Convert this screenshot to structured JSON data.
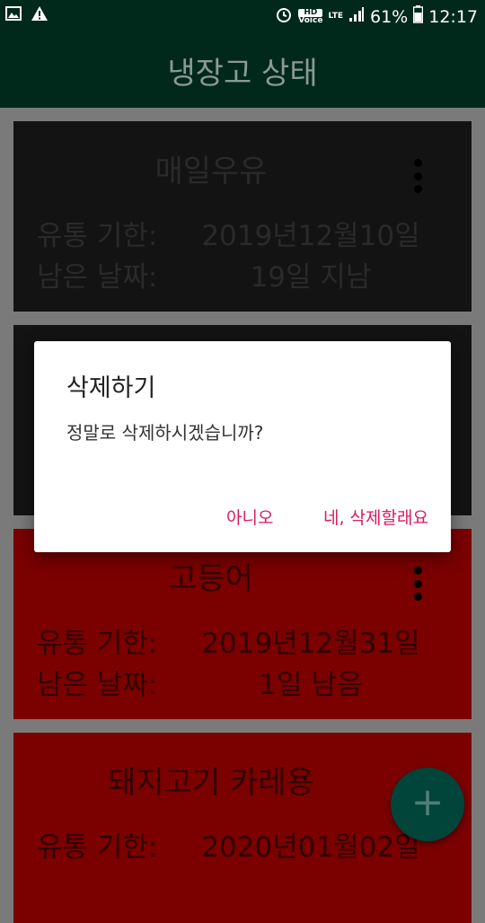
{
  "status_bar": {
    "hd_label": "HD",
    "voice_label": "Voice",
    "lte_label": "LTE",
    "battery": "61%",
    "time": "12:17",
    "icons": [
      "gallery-icon",
      "warning-icon",
      "alarm-icon",
      "signal-icon",
      "battery-icon"
    ]
  },
  "app_bar": {
    "title": "냉장고 상태"
  },
  "cards": [
    {
      "name": "매일우유",
      "expiry_label": "유통 기한:",
      "expiry": "2019년12월10일",
      "remain_label": "남은 날짜:",
      "remain": "19일 지남",
      "style": "dark"
    },
    {
      "name": "고등어",
      "expiry_label": "유통 기한:",
      "expiry": "2019년12월31일",
      "remain_label": "남은 날짜:",
      "remain": "1일 남음",
      "style": "red"
    },
    {
      "name": "돼지고기 카레용",
      "expiry_label": "유통 기한:",
      "expiry": "2020년01월02일",
      "style": "red"
    }
  ],
  "dialog": {
    "title": "삭제하기",
    "message": "정말로 삭제하시겠습니까?",
    "no_label": "아니오",
    "yes_label": "네, 삭제할래요"
  },
  "fab": {
    "label": "+"
  },
  "colors": {
    "app_bar": "#00281b",
    "accent": "#d81b60",
    "expired_card": "#131313",
    "warning_card": "#7b0000"
  }
}
